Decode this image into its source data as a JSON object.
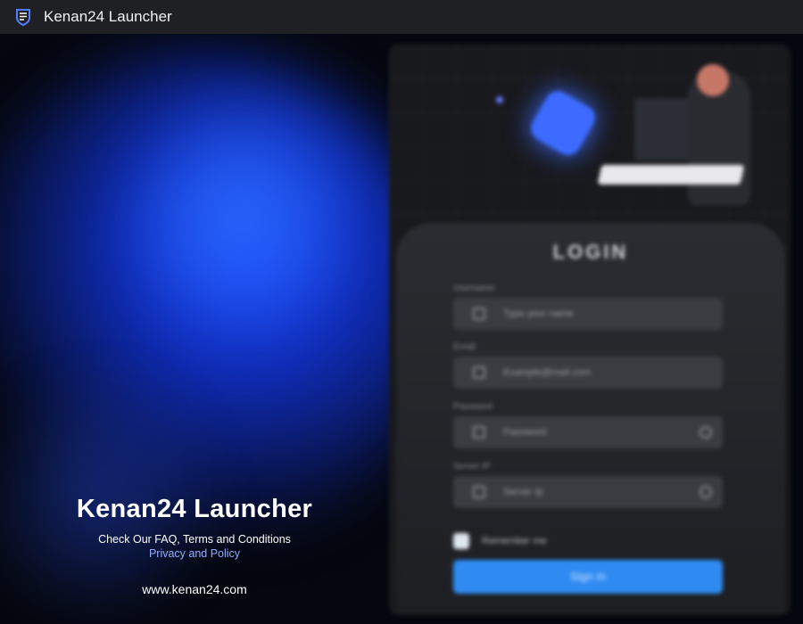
{
  "window": {
    "title": "Kenan24 Launcher",
    "app_icon": "shield-logo-icon"
  },
  "brand": {
    "title": "Kenan24 Launcher",
    "subtitle_line1": "Check Our FAQ, Terms and Conditions",
    "subtitle_line2": "Privacy and Policy",
    "website": "www.kenan24.com",
    "link_color": "#8fb0ff"
  },
  "login": {
    "title": "LOGIN",
    "fields": [
      {
        "label": "Username",
        "placeholder": "Type your name",
        "icon": "user-icon"
      },
      {
        "label": "Email",
        "placeholder": "Example@mail.com",
        "icon": "mail-icon"
      },
      {
        "label": "Password",
        "placeholder": "Password",
        "icon": "pen-icon",
        "trail_icon": "eye-icon"
      },
      {
        "label": "Server IP",
        "placeholder": "Server Ip",
        "icon": "server-icon",
        "trail_icon": "chevron-down-icon"
      }
    ],
    "remember_label": "Remember me",
    "signin_label": "Sign in",
    "accent_color": "#2f8bf2"
  }
}
